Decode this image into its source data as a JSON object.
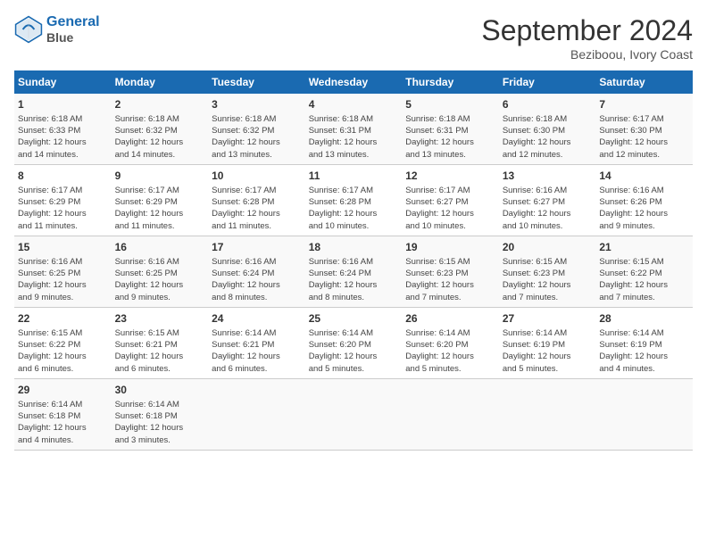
{
  "header": {
    "logo_line1": "General",
    "logo_line2": "Blue",
    "month": "September 2024",
    "location": "Beziboou, Ivory Coast"
  },
  "days_of_week": [
    "Sunday",
    "Monday",
    "Tuesday",
    "Wednesday",
    "Thursday",
    "Friday",
    "Saturday"
  ],
  "weeks": [
    [
      {
        "day": "1",
        "info": "Sunrise: 6:18 AM\nSunset: 6:33 PM\nDaylight: 12 hours\nand 14 minutes."
      },
      {
        "day": "2",
        "info": "Sunrise: 6:18 AM\nSunset: 6:32 PM\nDaylight: 12 hours\nand 14 minutes."
      },
      {
        "day": "3",
        "info": "Sunrise: 6:18 AM\nSunset: 6:32 PM\nDaylight: 12 hours\nand 13 minutes."
      },
      {
        "day": "4",
        "info": "Sunrise: 6:18 AM\nSunset: 6:31 PM\nDaylight: 12 hours\nand 13 minutes."
      },
      {
        "day": "5",
        "info": "Sunrise: 6:18 AM\nSunset: 6:31 PM\nDaylight: 12 hours\nand 13 minutes."
      },
      {
        "day": "6",
        "info": "Sunrise: 6:18 AM\nSunset: 6:30 PM\nDaylight: 12 hours\nand 12 minutes."
      },
      {
        "day": "7",
        "info": "Sunrise: 6:17 AM\nSunset: 6:30 PM\nDaylight: 12 hours\nand 12 minutes."
      }
    ],
    [
      {
        "day": "8",
        "info": "Sunrise: 6:17 AM\nSunset: 6:29 PM\nDaylight: 12 hours\nand 11 minutes."
      },
      {
        "day": "9",
        "info": "Sunrise: 6:17 AM\nSunset: 6:29 PM\nDaylight: 12 hours\nand 11 minutes."
      },
      {
        "day": "10",
        "info": "Sunrise: 6:17 AM\nSunset: 6:28 PM\nDaylight: 12 hours\nand 11 minutes."
      },
      {
        "day": "11",
        "info": "Sunrise: 6:17 AM\nSunset: 6:28 PM\nDaylight: 12 hours\nand 10 minutes."
      },
      {
        "day": "12",
        "info": "Sunrise: 6:17 AM\nSunset: 6:27 PM\nDaylight: 12 hours\nand 10 minutes."
      },
      {
        "day": "13",
        "info": "Sunrise: 6:16 AM\nSunset: 6:27 PM\nDaylight: 12 hours\nand 10 minutes."
      },
      {
        "day": "14",
        "info": "Sunrise: 6:16 AM\nSunset: 6:26 PM\nDaylight: 12 hours\nand 9 minutes."
      }
    ],
    [
      {
        "day": "15",
        "info": "Sunrise: 6:16 AM\nSunset: 6:25 PM\nDaylight: 12 hours\nand 9 minutes."
      },
      {
        "day": "16",
        "info": "Sunrise: 6:16 AM\nSunset: 6:25 PM\nDaylight: 12 hours\nand 9 minutes."
      },
      {
        "day": "17",
        "info": "Sunrise: 6:16 AM\nSunset: 6:24 PM\nDaylight: 12 hours\nand 8 minutes."
      },
      {
        "day": "18",
        "info": "Sunrise: 6:16 AM\nSunset: 6:24 PM\nDaylight: 12 hours\nand 8 minutes."
      },
      {
        "day": "19",
        "info": "Sunrise: 6:15 AM\nSunset: 6:23 PM\nDaylight: 12 hours\nand 7 minutes."
      },
      {
        "day": "20",
        "info": "Sunrise: 6:15 AM\nSunset: 6:23 PM\nDaylight: 12 hours\nand 7 minutes."
      },
      {
        "day": "21",
        "info": "Sunrise: 6:15 AM\nSunset: 6:22 PM\nDaylight: 12 hours\nand 7 minutes."
      }
    ],
    [
      {
        "day": "22",
        "info": "Sunrise: 6:15 AM\nSunset: 6:22 PM\nDaylight: 12 hours\nand 6 minutes."
      },
      {
        "day": "23",
        "info": "Sunrise: 6:15 AM\nSunset: 6:21 PM\nDaylight: 12 hours\nand 6 minutes."
      },
      {
        "day": "24",
        "info": "Sunrise: 6:14 AM\nSunset: 6:21 PM\nDaylight: 12 hours\nand 6 minutes."
      },
      {
        "day": "25",
        "info": "Sunrise: 6:14 AM\nSunset: 6:20 PM\nDaylight: 12 hours\nand 5 minutes."
      },
      {
        "day": "26",
        "info": "Sunrise: 6:14 AM\nSunset: 6:20 PM\nDaylight: 12 hours\nand 5 minutes."
      },
      {
        "day": "27",
        "info": "Sunrise: 6:14 AM\nSunset: 6:19 PM\nDaylight: 12 hours\nand 5 minutes."
      },
      {
        "day": "28",
        "info": "Sunrise: 6:14 AM\nSunset: 6:19 PM\nDaylight: 12 hours\nand 4 minutes."
      }
    ],
    [
      {
        "day": "29",
        "info": "Sunrise: 6:14 AM\nSunset: 6:18 PM\nDaylight: 12 hours\nand 4 minutes."
      },
      {
        "day": "30",
        "info": "Sunrise: 6:14 AM\nSunset: 6:18 PM\nDaylight: 12 hours\nand 3 minutes."
      },
      {
        "day": "",
        "info": ""
      },
      {
        "day": "",
        "info": ""
      },
      {
        "day": "",
        "info": ""
      },
      {
        "day": "",
        "info": ""
      },
      {
        "day": "",
        "info": ""
      }
    ]
  ]
}
